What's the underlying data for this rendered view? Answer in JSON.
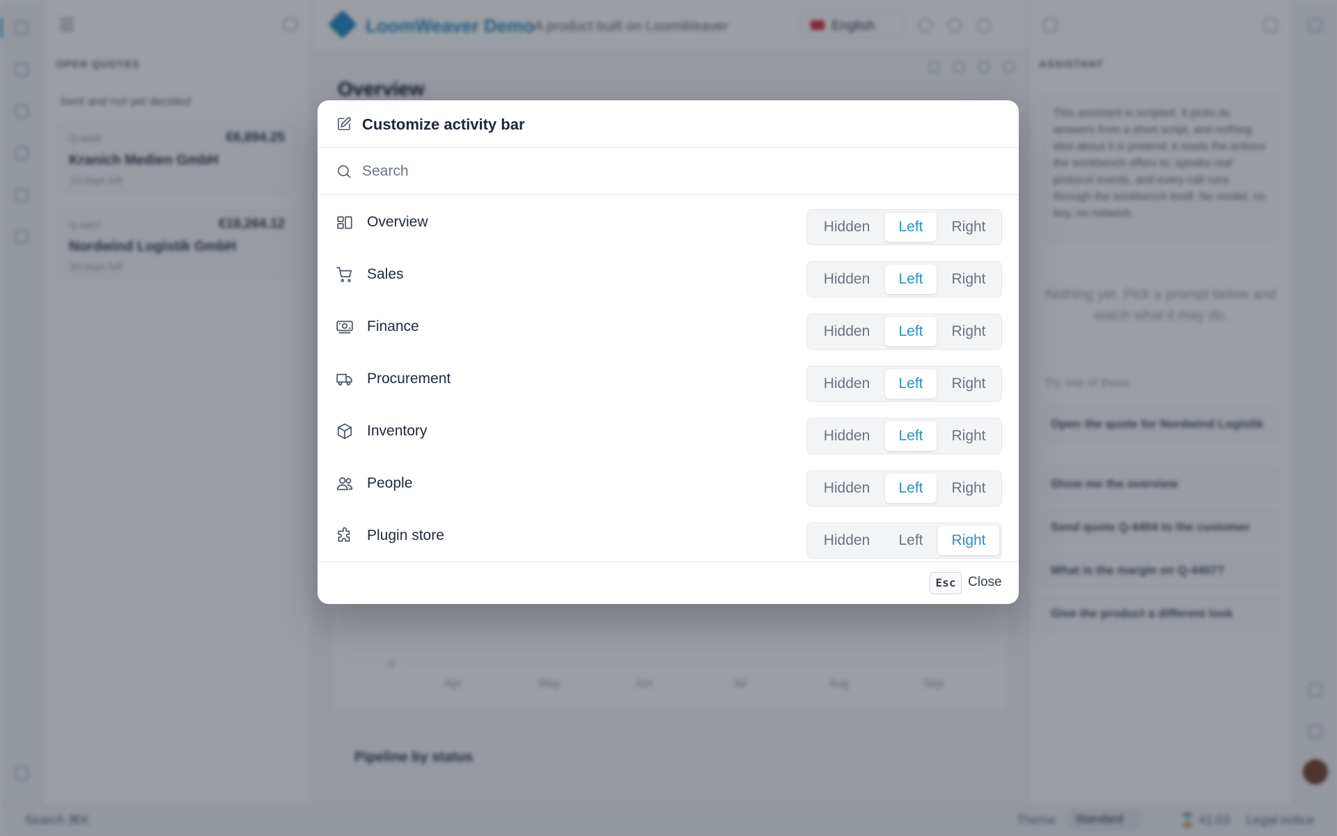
{
  "background": {
    "left_panel": {
      "section_title": "OPEN QUOTES",
      "subtitle": "Sent and not yet decided",
      "quotes": [
        {
          "id": "Q-4406",
          "amount": "€6,894.25",
          "customer": "Kranich Medien GmbH",
          "age": "10 days left"
        },
        {
          "id": "Q-4407",
          "amount": "€18,264.12",
          "customer": "Nordwind Logistik GmbH",
          "age": "20 days left"
        }
      ]
    },
    "header": {
      "brand_name": "LoomWeaver Demo",
      "tagline": "A product built on LoomWeaver",
      "language": "English"
    },
    "main": {
      "page_title": "Overview",
      "chart_zero": "0",
      "months": [
        "Apr",
        "May",
        "Jun",
        "Jul",
        "Aug",
        "Sep"
      ],
      "pipeline_title": "Pipeline by status"
    },
    "assistant": {
      "section_title": "ASSISTANT",
      "note": "This assistant is scripted. It picks its answers from a short script, and nothing else about it is pretend: it reads the actions the workbench offers to; speaks real protocol events, and every call runs through the workbench itself. No model, no key, no network.",
      "empty": "Nothing yet. Pick a prompt below and watch what it may do.",
      "try_label": "Try one of these",
      "prompts": [
        "Open the quote for Nordwind Logistik",
        "Show me the overview",
        "Send quote Q-4404 to the customer",
        "What is the margin on Q-4407?",
        "Give the product a different look"
      ]
    },
    "statusbar": {
      "search_label": "Search ⌘K",
      "theme_label": "Theme",
      "theme_value": "Standard",
      "time": "⌛ 41:03",
      "legal": "Legal notice"
    }
  },
  "modal": {
    "title": "Customize activity bar",
    "search_placeholder": "Search",
    "search_value": "",
    "options": [
      "Hidden",
      "Left",
      "Right"
    ],
    "items": [
      {
        "label": "Overview",
        "icon": "layout-dashboard-icon",
        "selected": "Left"
      },
      {
        "label": "Sales",
        "icon": "shopping-cart-icon",
        "selected": "Left"
      },
      {
        "label": "Finance",
        "icon": "banknote-icon",
        "selected": "Left"
      },
      {
        "label": "Procurement",
        "icon": "truck-icon",
        "selected": "Left"
      },
      {
        "label": "Inventory",
        "icon": "box-icon",
        "selected": "Left"
      },
      {
        "label": "People",
        "icon": "users-icon",
        "selected": "Left"
      },
      {
        "label": "Plugin store",
        "icon": "puzzle-icon",
        "selected": "Right"
      }
    ],
    "footer": {
      "esc_key": "Esc",
      "close_label": "Close"
    },
    "accent_color": "#2b8fc4"
  }
}
